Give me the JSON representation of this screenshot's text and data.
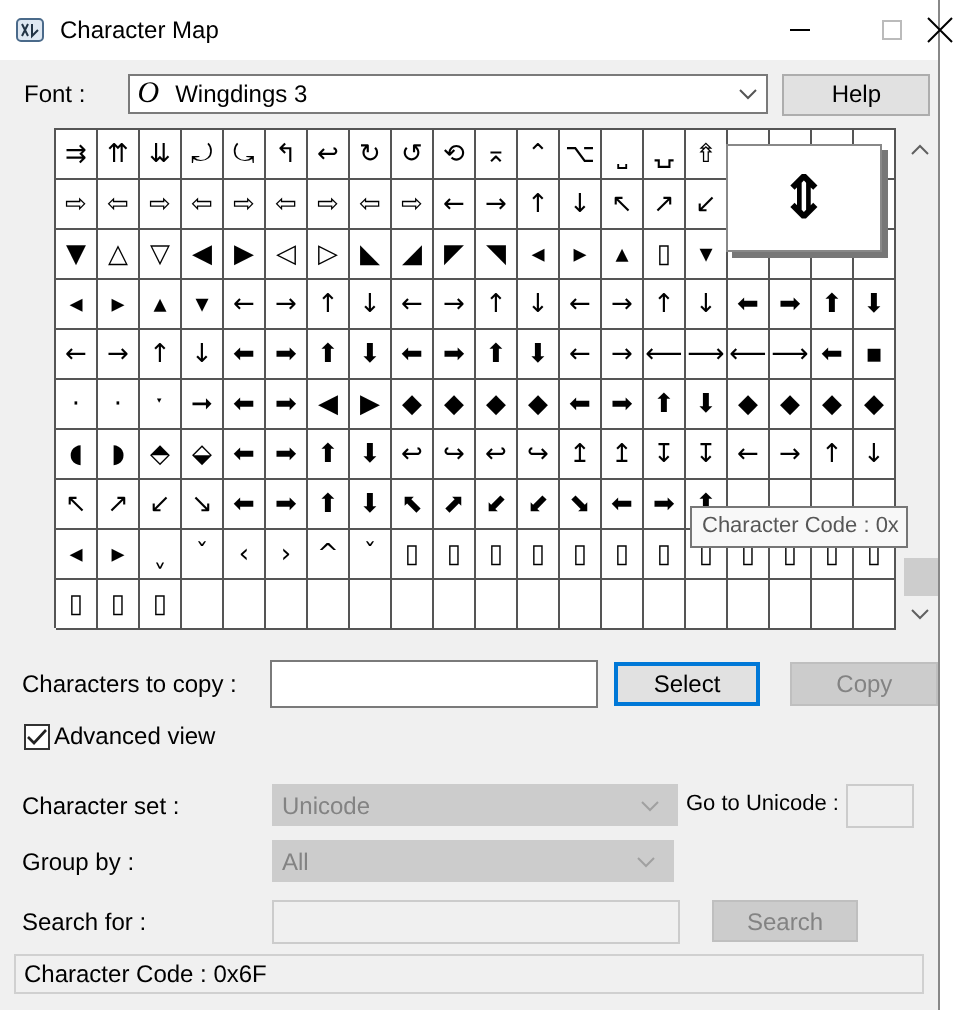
{
  "window": {
    "title": "Character Map"
  },
  "font": {
    "label": "Font :",
    "type_icon": "O",
    "value": "Wingdings 3",
    "help": "Help"
  },
  "grid": {
    "rows": [
      [
        "⇉",
        "⇈",
        "⇊",
        "⤾",
        "⤿",
        "↰",
        "↩",
        "↻",
        "↺",
        "⟲",
        "⌅",
        "⌃",
        "⌥",
        "⎵",
        "⍽",
        "⇮",
        null,
        null,
        null,
        null
      ],
      [
        "⇨",
        "⇦",
        "⇨",
        "⇦",
        "⇨",
        "⇦",
        "⇨",
        "⇦",
        "⇨",
        "←",
        "→",
        "↑",
        "↓",
        "↖",
        "↗",
        "↙",
        null,
        null,
        null,
        null
      ],
      [
        "▼",
        "△",
        "▽",
        "◀",
        "▶",
        "◁",
        "▷",
        "◣",
        "◢",
        "◤",
        "◥",
        "◂",
        "▸",
        "▴",
        "▯",
        "▾",
        null,
        null,
        null,
        null
      ],
      [
        "◂",
        "▸",
        "▴",
        "▾",
        "←",
        "→",
        "↑",
        "↓",
        "←",
        "→",
        "↑",
        "↓",
        "←",
        "→",
        "↑",
        "↓",
        "⬅",
        "➡",
        "⬆",
        "⬇"
      ],
      [
        "←",
        "→",
        "↑",
        "↓",
        "⬅",
        "➡",
        "⬆",
        "⬇",
        "⬅",
        "➡",
        "⬆",
        "⬇",
        "←",
        "→",
        "⟵",
        "⟶",
        "⟵",
        "⟶",
        "⬅",
        "▪"
      ],
      [
        "·",
        "·",
        "ˑ",
        "➞",
        "⬅",
        "➡",
        "◀",
        "▶",
        "◆",
        "◆",
        "◆",
        "◆",
        "⬅",
        "➡",
        "⬆",
        "⬇",
        "◆",
        "◆",
        "◆",
        "◆"
      ],
      [
        "◖",
        "◗",
        "⬘",
        "⬙",
        "⬅",
        "➡",
        "⬆",
        "⬇",
        "↩",
        "↪",
        "↩",
        "↪",
        "↥",
        "↥",
        "↧",
        "↧",
        "←",
        "→",
        "↑",
        "↓"
      ],
      [
        "↖",
        "↗",
        "↙",
        "↘",
        "⬅",
        "➡",
        "⬆",
        "⬇",
        "⬉",
        "⬈",
        "⬋",
        "⬋",
        "⬊",
        "⬅",
        "➡",
        "⬆",
        null,
        null,
        null,
        null
      ],
      [
        "◂",
        "▸",
        "ˬ",
        "ˇ",
        "‹",
        "›",
        "^",
        "ˇ",
        "▯",
        "▯",
        "▯",
        "▯",
        "▯",
        "▯",
        "▯",
        "▯",
        "▯",
        "▯",
        "▯",
        "▯"
      ],
      [
        "▯",
        "▯",
        "▯"
      ]
    ],
    "magnifier": "⇕",
    "tooltip": "Character Code : 0x"
  },
  "copy": {
    "label": "Characters to copy :",
    "select": "Select",
    "copy": "Copy",
    "copy_disabled": true
  },
  "advanced": {
    "label": "Advanced view",
    "checked": true
  },
  "charset": {
    "label": "Character set :",
    "value": "Unicode",
    "disabled": true,
    "goto_label": "Go to Unicode :"
  },
  "group": {
    "label": "Group by :",
    "value": "All",
    "disabled": true
  },
  "search": {
    "label": "Search for :",
    "button": "Search",
    "disabled": true
  },
  "status_bar": "Character Code : 0x6F"
}
